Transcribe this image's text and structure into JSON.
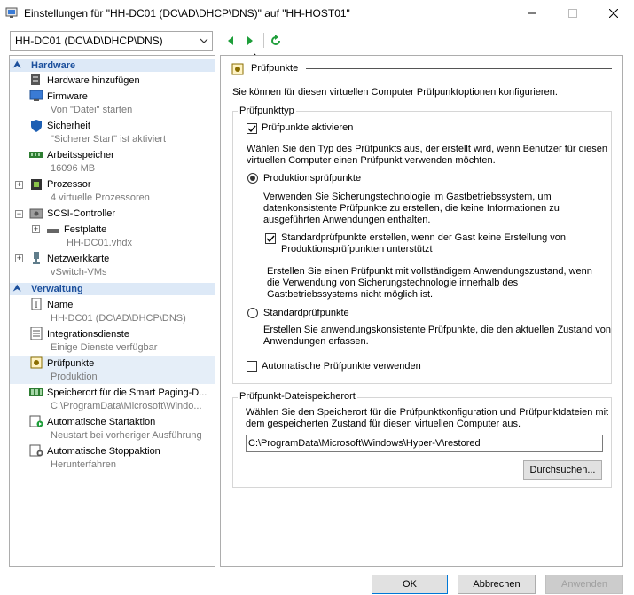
{
  "window": {
    "title": "Einstellungen für \"HH-DC01 (DC\\AD\\DHCP\\DNS)\" auf \"HH-HOST01\""
  },
  "toolbar": {
    "vm_selected": "HH-DC01 (DC\\AD\\DHCP\\DNS)"
  },
  "tree": {
    "hardware_header": "Hardware",
    "items_hardware": [
      {
        "label": "Hardware hinzufügen",
        "sub": "",
        "icon": "add-hardware-icon"
      },
      {
        "label": "Firmware",
        "sub": "Von \"Datei\" starten",
        "icon": "firmware-icon"
      },
      {
        "label": "Sicherheit",
        "sub": "\"Sicherer Start\" ist aktiviert",
        "icon": "shield-icon"
      },
      {
        "label": "Arbeitsspeicher",
        "sub": "16096 MB",
        "icon": "memory-icon"
      },
      {
        "label": "Prozessor",
        "sub": "4 virtuelle Prozessoren",
        "icon": "processor-icon"
      },
      {
        "label": "SCSI-Controller",
        "sub": "",
        "icon": "scsi-icon"
      },
      {
        "label": "Festplatte",
        "sub": "HH-DC01.vhdx",
        "icon": "hard-disk-icon"
      },
      {
        "label": "Netzwerkkarte",
        "sub": "vSwitch-VMs",
        "icon": "network-adapter-icon"
      }
    ],
    "management_header": "Verwaltung",
    "items_management": [
      {
        "label": "Name",
        "sub": "HH-DC01 (DC\\AD\\DHCP\\DNS)",
        "icon": "name-icon"
      },
      {
        "label": "Integrationsdienste",
        "sub": "Einige Dienste verfügbar",
        "icon": "integration-services-icon"
      },
      {
        "label": "Prüfpunkte",
        "sub": "Produktion",
        "icon": "checkpoint-icon"
      },
      {
        "label": "Speicherort für die Smart Paging-D...",
        "sub": "C:\\ProgramData\\Microsoft\\Windo...",
        "icon": "smart-paging-icon"
      },
      {
        "label": "Automatische Startaktion",
        "sub": "Neustart bei vorheriger Ausführung",
        "icon": "auto-start-icon"
      },
      {
        "label": "Automatische Stoppaktion",
        "sub": "Herunterfahren",
        "icon": "auto-stop-icon"
      }
    ]
  },
  "checkpoints": {
    "title": "Prüfpunkte",
    "description": "Sie können für diesen virtuellen Computer Prüfpunktoptionen konfigurieren.",
    "type_group_title": "Prüfpunkttyp",
    "enable_label": "Prüfpunkte aktivieren",
    "enable_checked": true,
    "choose_text": "Wählen Sie den Typ des Prüfpunkts aus, der erstellt wird, wenn Benutzer für diesen virtuellen Computer einen Prüfpunkt verwenden möchten.",
    "production_label": "Produktionsprüfpunkte",
    "production_selected": true,
    "production_desc": "Verwenden Sie Sicherungstechnologie im Gastbetriebssystem, um datenkonsistente Prüfpunkte zu erstellen, die keine Informationen zu ausgeführten Anwendungen enthalten.",
    "fallback_label": "Standardprüfpunkte erstellen, wenn der Gast keine Erstellung von Produktionsprüfpunkten unterstützt",
    "fallback_checked": true,
    "fallback_desc": "Erstellen Sie einen Prüfpunkt mit vollständigem Anwendungszustand, wenn die Verwendung von Sicherungstechnologie innerhalb des Gastbetriebssystems nicht möglich ist.",
    "standard_label": "Standardprüfpunkte",
    "standard_selected": false,
    "standard_desc": "Erstellen Sie anwendungskonsistente Prüfpunkte, die den aktuellen Zustand von Anwendungen erfassen.",
    "auto_label": "Automatische Prüfpunkte verwenden",
    "auto_checked": false,
    "location_group_title": "Prüfpunkt-Dateispeicherort",
    "location_desc": "Wählen Sie den Speicherort für die Prüfpunktkonfiguration und Prüfpunktdateien mit dem gespeicherten Zustand für diesen virtuellen Computer aus.",
    "location_path": "C:\\ProgramData\\Microsoft\\Windows\\Hyper-V\\restored",
    "browse_label": "Durchsuchen..."
  },
  "footer": {
    "ok_label": "OK",
    "cancel_label": "Abbrechen",
    "apply_label": "Anwenden"
  },
  "colors": {
    "section_header_bg": "#dde9f7",
    "section_header_text": "#1b4f9c",
    "nav_green": "#1e9e3a",
    "primary_border": "#0078d7"
  }
}
